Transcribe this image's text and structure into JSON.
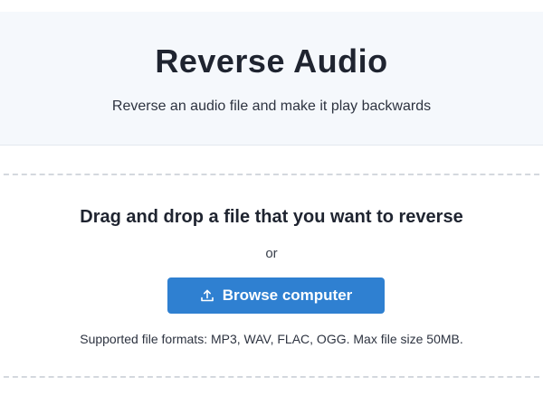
{
  "header": {
    "title": "Reverse Audio",
    "subtitle": "Reverse an audio file and make it play backwards"
  },
  "dropzone": {
    "prompt": "Drag and drop a file that you want to reverse",
    "or_label": "or",
    "browse_button_label": "Browse computer",
    "browse_button_icon": "upload-icon",
    "supported_formats": "Supported file formats: MP3, WAV, FLAC, OGG. Max file size 50MB."
  },
  "colors": {
    "accent": "#2f80d1",
    "hero_background": "#f5f8fc",
    "dashed_border": "#d4d8de"
  }
}
